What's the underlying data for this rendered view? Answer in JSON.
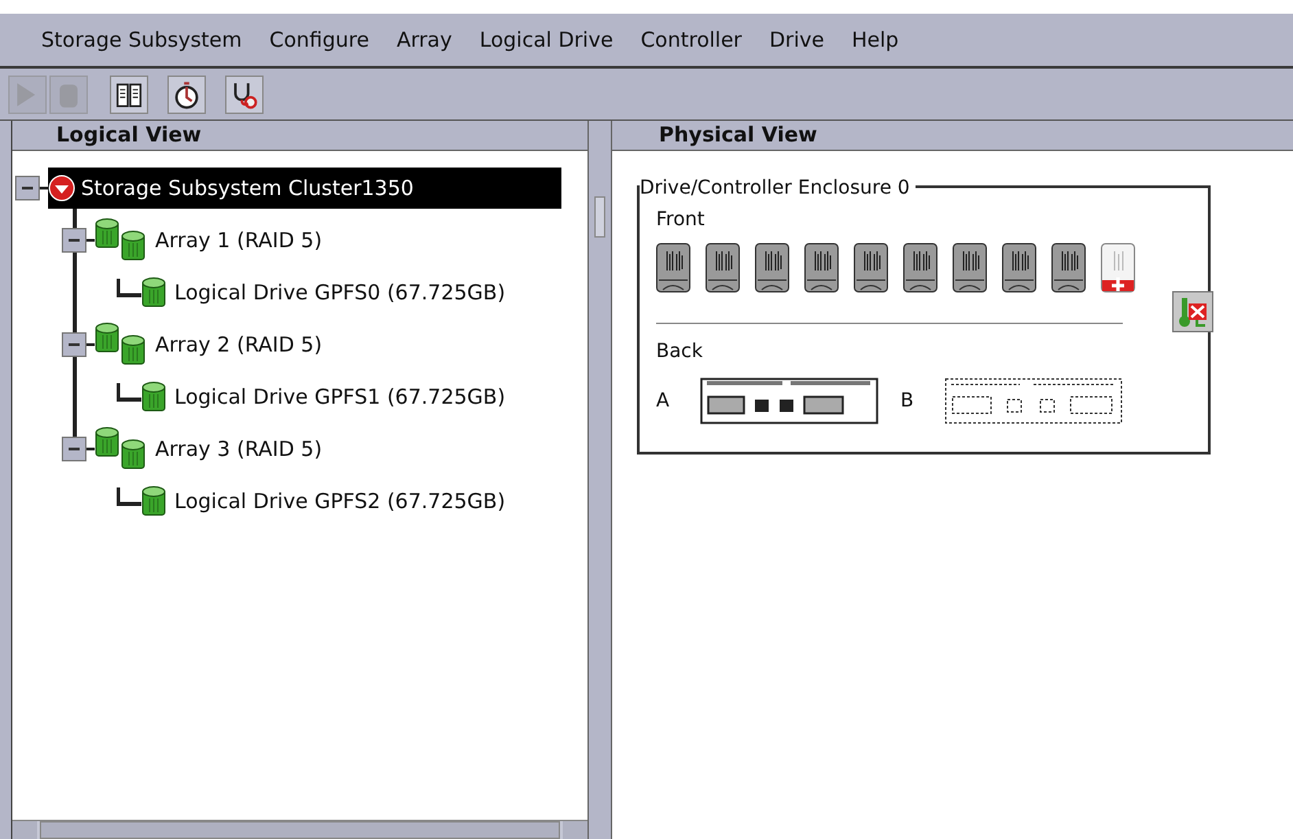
{
  "menu": [
    {
      "label": "Storage Subsystem"
    },
    {
      "label": "Configure"
    },
    {
      "label": "Array"
    },
    {
      "label": "Logical Drive"
    },
    {
      "label": "Controller"
    },
    {
      "label": "Drive"
    },
    {
      "label": "Help"
    }
  ],
  "toolbar": [
    {
      "kind": "arrow",
      "disabled": true
    },
    {
      "kind": "cylinder",
      "disabled": true
    },
    {
      "kind": "book",
      "disabled": false
    },
    {
      "kind": "stopwatch",
      "disabled": false
    },
    {
      "kind": "stethoscope",
      "disabled": false
    }
  ],
  "logical_view": {
    "title": "Logical View",
    "tree": [
      {
        "kind": "subsystem",
        "label": "Storage Subsystem Cluster1350",
        "selected": true,
        "expanded": true,
        "children": [
          {
            "kind": "array",
            "label": "Array 1 (RAID 5)",
            "selected": false,
            "expanded": true,
            "children": [
              {
                "kind": "drive",
                "label": "Logical Drive GPFS0 (67.725GB)",
                "selected": false
              }
            ]
          },
          {
            "kind": "array",
            "label": "Array 2 (RAID 5)",
            "selected": false,
            "expanded": true,
            "children": [
              {
                "kind": "drive",
                "label": "Logical Drive GPFS1 (67.725GB)",
                "selected": false
              }
            ]
          },
          {
            "kind": "array",
            "label": "Array 3 (RAID 5)",
            "selected": false,
            "expanded": true,
            "children": [
              {
                "kind": "drive",
                "label": "Logical Drive GPFS2 (67.725GB)",
                "selected": false
              }
            ]
          }
        ]
      }
    ]
  },
  "physical_view": {
    "title": "Physical View",
    "enclosure": {
      "title": "Drive/Controller Enclosure 0",
      "front_label": "Front",
      "drives": [
        {
          "kind": "drive"
        },
        {
          "kind": "drive"
        },
        {
          "kind": "drive"
        },
        {
          "kind": "drive"
        },
        {
          "kind": "drive"
        },
        {
          "kind": "drive"
        },
        {
          "kind": "drive"
        },
        {
          "kind": "drive"
        },
        {
          "kind": "drive"
        },
        {
          "kind": "hot_spare"
        }
      ],
      "back_label": "Back",
      "controllers": [
        {
          "label": "A",
          "present": true
        },
        {
          "label": "B",
          "present": false
        }
      ]
    }
  }
}
